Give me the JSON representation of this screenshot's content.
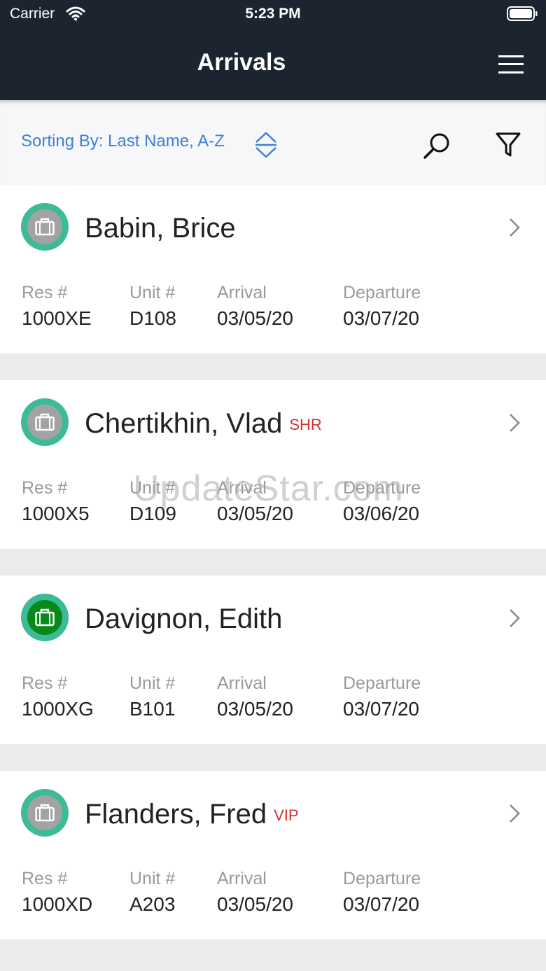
{
  "status_bar": {
    "carrier": "Carrier",
    "time": "5:23 PM"
  },
  "header": {
    "title": "Arrivals"
  },
  "sort_bar": {
    "label": "Sorting By: Last Name, A-Z"
  },
  "columns": {
    "res": "Res #",
    "unit": "Unit #",
    "arrival": "Arrival",
    "departure": "Departure"
  },
  "reservations": [
    {
      "name": "Babin, Brice",
      "tag": "",
      "res": "1000XE",
      "unit": "D108",
      "arrival": "03/05/20",
      "departure": "03/07/20",
      "status_icon": "luggage-icon"
    },
    {
      "name": "Chertikhin, Vlad",
      "tag": "SHR",
      "res": "1000X5",
      "unit": "D109",
      "arrival": "03/05/20",
      "departure": "03/06/20",
      "status_icon": "luggage-icon"
    },
    {
      "name": "Davignon, Edith",
      "tag": "",
      "res": "1000XG",
      "unit": "B101",
      "arrival": "03/05/20",
      "departure": "03/07/20",
      "status_icon": "luggage-icon"
    },
    {
      "name": "Flanders, Fred",
      "tag": "VIP",
      "res": "1000XD",
      "unit": "A203",
      "arrival": "03/05/20",
      "departure": "03/07/20",
      "status_icon": "luggage-icon"
    }
  ],
  "watermark": "UpdateStar.com",
  "colors": {
    "header_bg": "#1c2430",
    "accent": "#3f7fd9",
    "avatar_ring": "#3dbb98",
    "tag": "#d32f2f",
    "checked_in": "#078a1a"
  }
}
